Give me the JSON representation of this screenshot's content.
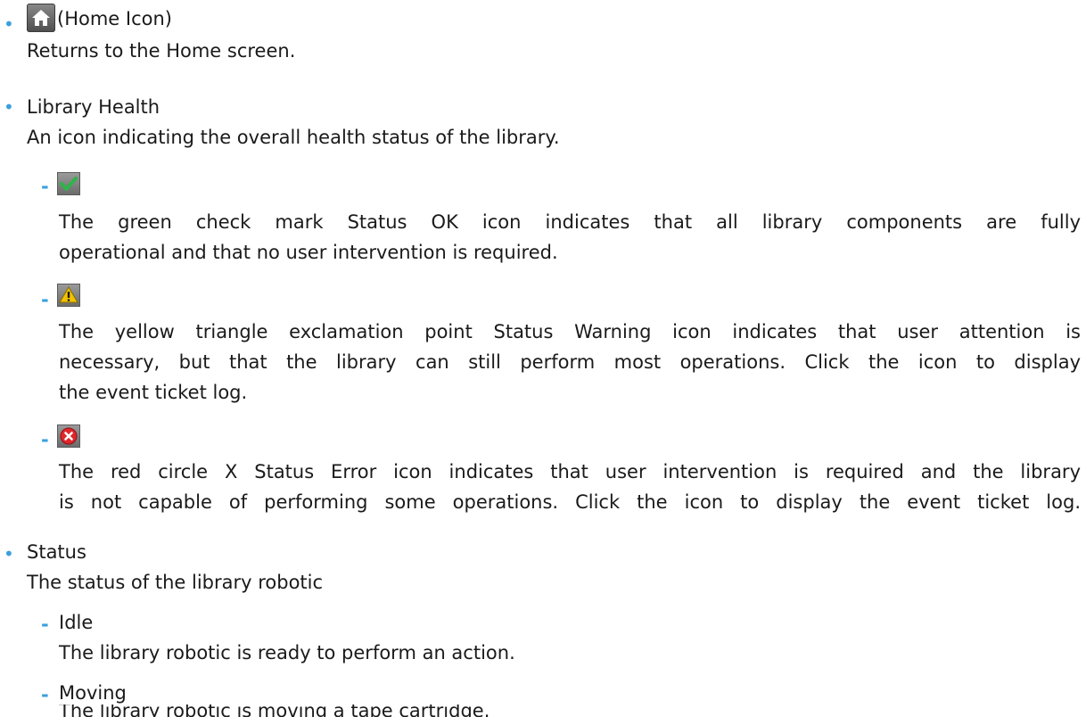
{
  "home": {
    "label": "(Home Icon)",
    "description": "Returns to the Home screen.",
    "icon": "home-icon"
  },
  "health": {
    "title": "Library Health",
    "description": "An icon indicating the overall health status of the library.",
    "ok": {
      "icon": "check-icon",
      "color": "#2fb34a",
      "line1": "The green check mark Status OK icon indicates that all library components are fully",
      "line2": "operational and that no user intervention is required."
    },
    "warning": {
      "icon": "warning-icon",
      "color": "#f2c200",
      "line1": "The yellow triangle exclamation point Status Warning icon indicates that user attention is",
      "line2": "necessary, but that the library can still perform most operations. Click the icon to display",
      "line3": "the event ticket log."
    },
    "error": {
      "icon": "error-icon",
      "color": "#e0262b",
      "line1": "The red circle X Status Error icon indicates that user intervention is required and the library",
      "line2": "is not capable of performing some operations. Click the icon to display the event ticket log."
    }
  },
  "status": {
    "title": "Status",
    "description": "The status of the library robotic",
    "idle": {
      "label": "Idle",
      "description": "The library robotic is ready to perform an action."
    },
    "moving": {
      "label": "Moving",
      "description": "The library robotic is moving a tape cartridge."
    }
  },
  "markers": {
    "bullet": "•",
    "dash": "-"
  },
  "accent_color": "#3aa0dd"
}
